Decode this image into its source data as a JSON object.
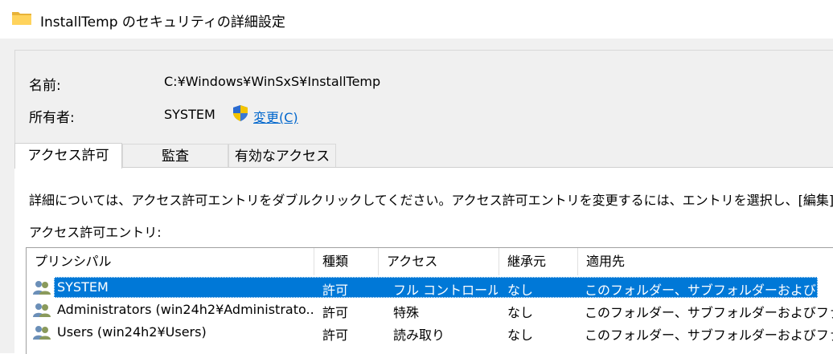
{
  "window": {
    "title": "InstallTemp のセキュリティの詳細設定",
    "icon": "folder-icon"
  },
  "fields": {
    "name_label": "名前:",
    "name_value": "C:¥Windows¥WinSxS¥InstallTemp",
    "owner_label": "所有者:",
    "owner_value": "SYSTEM",
    "change_link_text": "変更",
    "change_link_accel": "(C)"
  },
  "tabs": [
    {
      "label": "アクセス許可",
      "active": true
    },
    {
      "label": "監査",
      "active": false
    },
    {
      "label": "有効なアクセス",
      "active": false
    }
  ],
  "panel": {
    "info_text": "詳細については、アクセス許可エントリをダブルクリックしてください。アクセス許可エントリを変更するには、エントリを選択し、[編集] (使",
    "entries_label": "アクセス許可エントリ:"
  },
  "table": {
    "columns": [
      "プリンシパル",
      "種類",
      "アクセス",
      "継承元",
      "適用先"
    ],
    "rows": [
      {
        "principal": "SYSTEM",
        "type": "許可",
        "access": "フル コントロール",
        "inherited": "なし",
        "applies_to": "このフォルダー、サブフォルダーおよびファイル",
        "selected": true
      },
      {
        "principal": "Administrators (win24h2¥Administrato...",
        "type": "許可",
        "access": "特殊",
        "inherited": "なし",
        "applies_to": "このフォルダー、サブフォルダーおよびファイル",
        "selected": false
      },
      {
        "principal": "Users (win24h2¥Users)",
        "type": "許可",
        "access": "読み取り",
        "inherited": "なし",
        "applies_to": "このフォルダー、サブフォルダーおよびファイル",
        "selected": false
      }
    ]
  },
  "colors": {
    "selection": "#0078d7",
    "link": "#0066cc",
    "dialog_bg": "#f0f0f0"
  }
}
